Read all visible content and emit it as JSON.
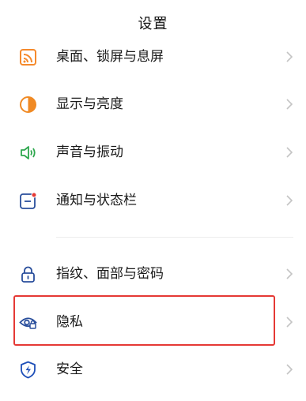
{
  "header": {
    "title": "设置"
  },
  "settings": {
    "items": [
      {
        "label": "桌面、锁屏与息屏",
        "icon": "wallpaper-icon"
      },
      {
        "label": "显示与亮度",
        "icon": "display-brightness-icon"
      },
      {
        "label": "声音与振动",
        "icon": "speaker-icon"
      },
      {
        "label": "通知与状态栏",
        "icon": "notification-icon"
      },
      {
        "label": "指纹、面部与密码",
        "icon": "lock-icon"
      },
      {
        "label": "隐私",
        "icon": "privacy-eye-icon"
      },
      {
        "label": "安全",
        "icon": "security-shield-icon"
      }
    ]
  },
  "colors": {
    "wallpaper_orange": "#f58a2c",
    "display_orange": "#f08a24",
    "sound_green": "#2fa84f",
    "notify_blue": "#2a4f9c",
    "notify_red_dot": "#e53935",
    "lock_blue": "#2a4f9c",
    "privacy_blue": "#2a4f9c",
    "shield_blue": "#1e4fb8",
    "highlight_red": "#e53935",
    "chevron_gray": "#c4c4c4"
  }
}
